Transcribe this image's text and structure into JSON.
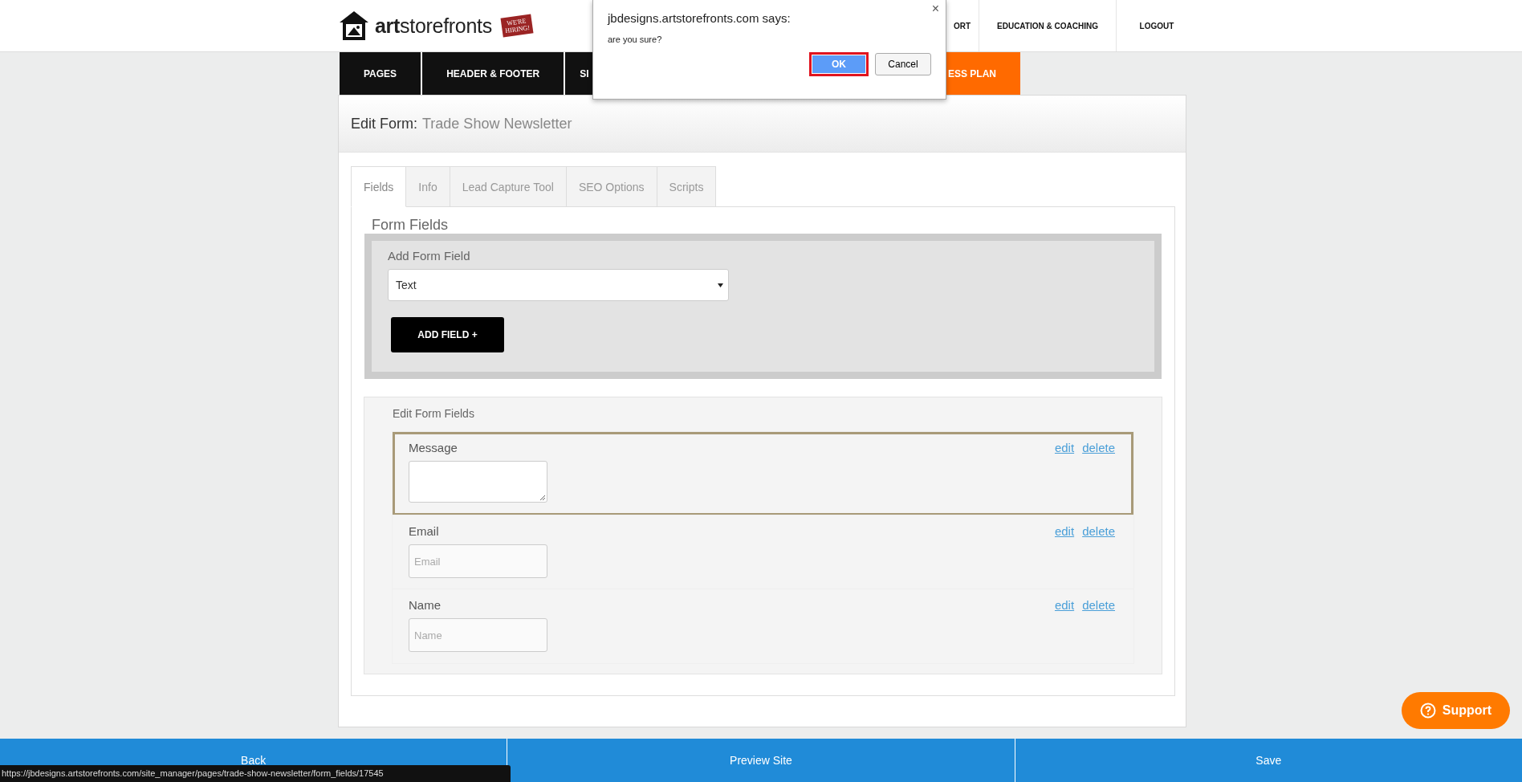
{
  "header": {
    "logo": "**art**storefronts",
    "hiring_sign": "WE'RE HIRING!",
    "nav": [
      {
        "label": "ORT",
        "kind": "cut"
      },
      {
        "label": "EDUCATION & COACHING",
        "kind": "full"
      },
      {
        "label": "LOGOUT",
        "kind": "full"
      }
    ]
  },
  "main_nav": [
    {
      "label": "PAGES",
      "kind": "dark"
    },
    {
      "label": "HEADER & FOOTER",
      "kind": "dark"
    },
    {
      "label": "SI",
      "kind": "cut"
    },
    {
      "label": "ESS PLAN",
      "kind": "accent"
    }
  ],
  "panel": {
    "title_prefix": "Edit Form:",
    "title": "Trade Show Newsletter",
    "tabs": [
      {
        "label": "Fields",
        "selected": true
      },
      {
        "label": "Info",
        "selected": false
      },
      {
        "label": "Lead Capture Tool",
        "selected": false
      },
      {
        "label": "SEO Options",
        "selected": false
      },
      {
        "label": "Scripts",
        "selected": false
      }
    ],
    "section_title": "Form Fields",
    "add_field": {
      "label": "Add Form Field",
      "select_value": "Text",
      "button": "ADD FIELD +"
    },
    "edit_fields": {
      "title": "Edit Form Fields",
      "rows": [
        {
          "label": "Message",
          "kind": "textarea",
          "placeholder": "",
          "selected": true,
          "edit": "edit",
          "delete": "delete"
        },
        {
          "label": "Email",
          "kind": "input",
          "placeholder": "Email",
          "selected": false,
          "edit": "edit",
          "delete": "delete"
        },
        {
          "label": "Name",
          "kind": "input",
          "placeholder": "Name",
          "selected": false,
          "edit": "edit",
          "delete": "delete"
        }
      ]
    }
  },
  "dialog": {
    "title": "jbdesigns.artstorefronts.com says:",
    "message": "are you sure?",
    "ok": "OK",
    "cancel": "Cancel",
    "close": "×"
  },
  "support_button": "Support",
  "footer": [
    "Back",
    "Preview Site",
    "Save"
  ],
  "status_url": "https://jbdesigns.artstorefronts.com/site_manager/pages/trade-show-newsletter/form_fields/17545"
}
